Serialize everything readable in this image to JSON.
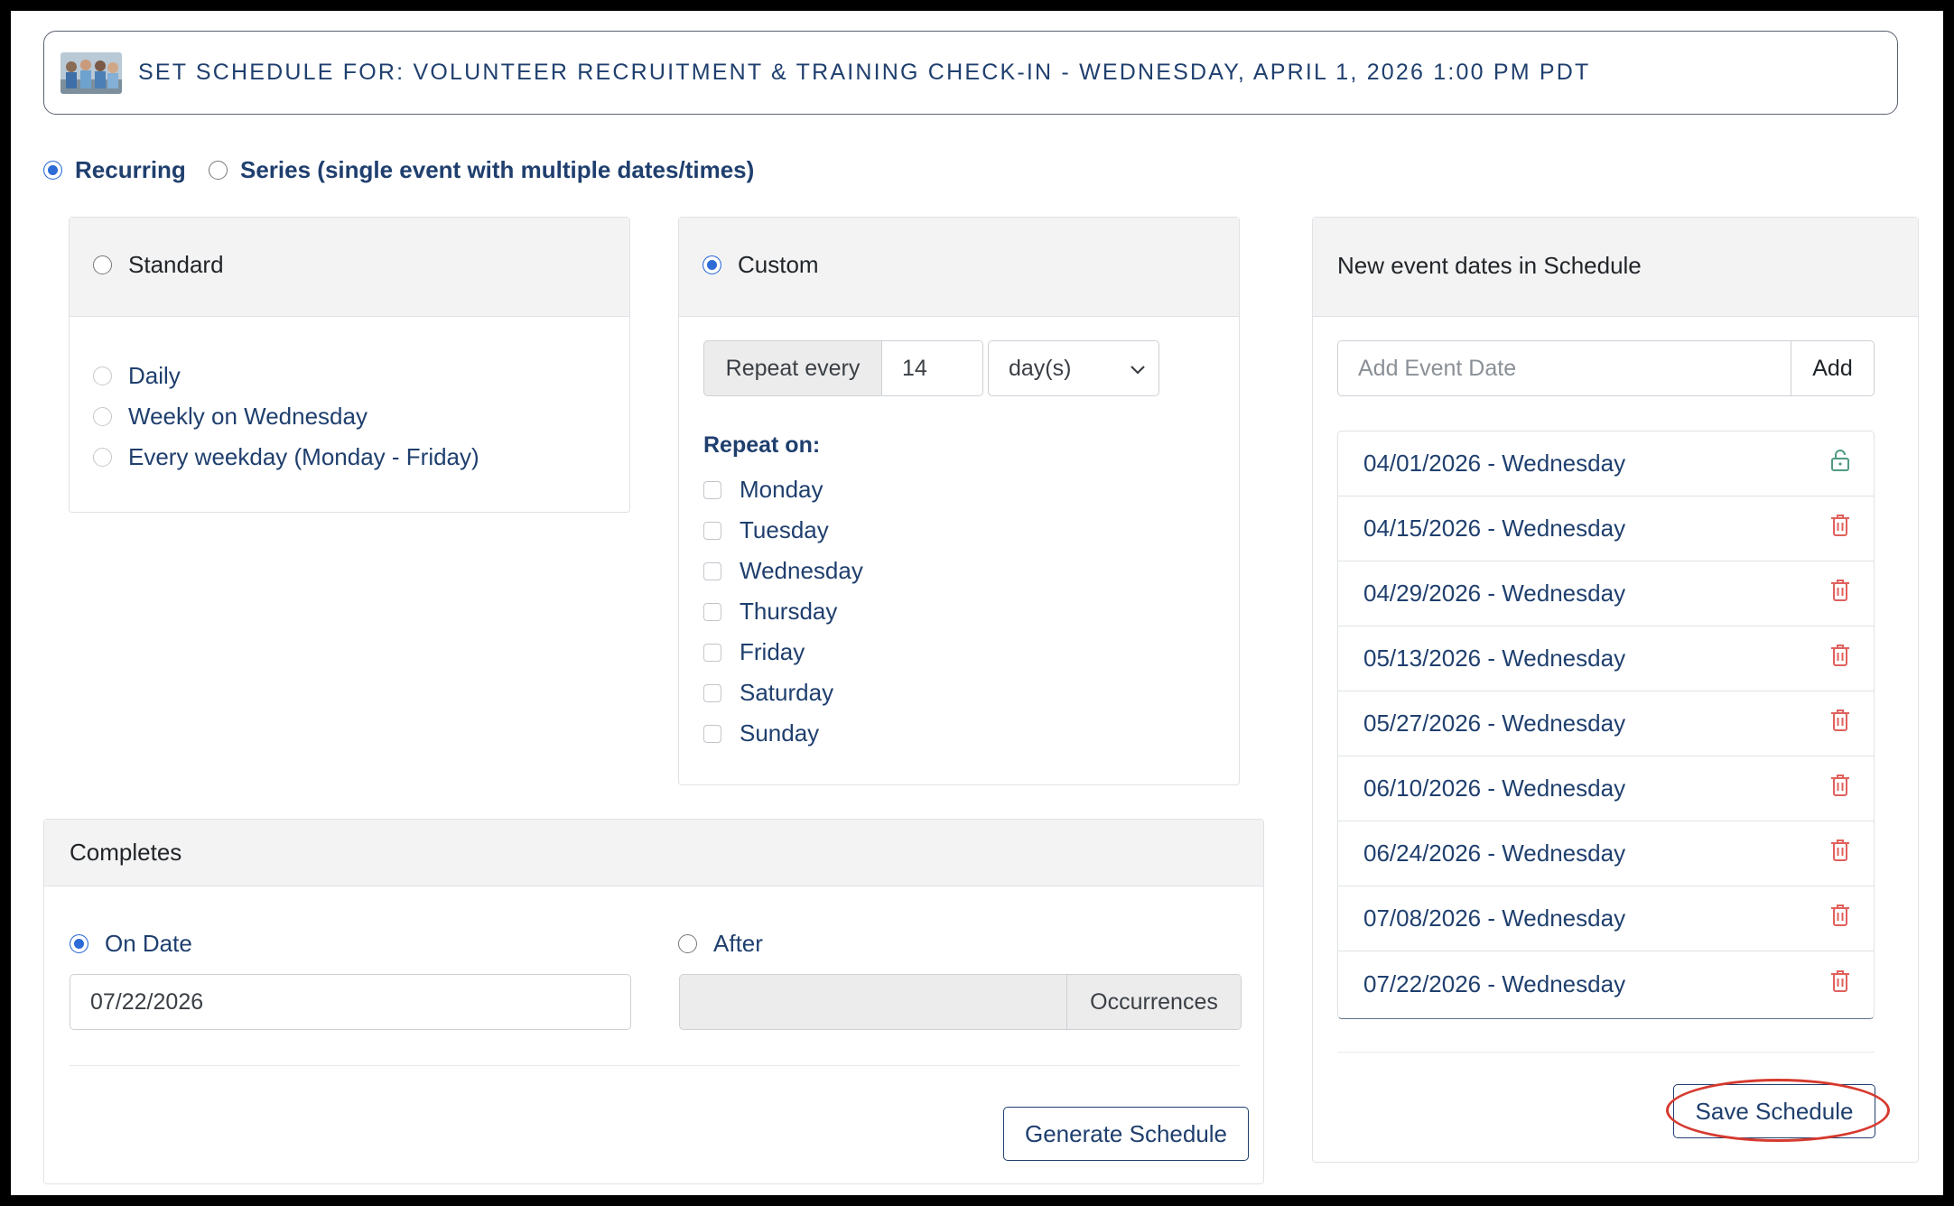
{
  "header": {
    "title": "SET SCHEDULE FOR: VOLUNTEER RECRUITMENT & TRAINING CHECK-IN - WEDNESDAY, APRIL 1, 2026 1:00 PM PDT"
  },
  "mode": {
    "recurring_label": "Recurring",
    "series_label": "Series (single event with multiple dates/times)"
  },
  "standard": {
    "label": "Standard",
    "options": [
      "Daily",
      "Weekly on Wednesday",
      "Every weekday (Monday - Friday)"
    ]
  },
  "custom": {
    "label": "Custom",
    "repeat_every_label": "Repeat every",
    "repeat_every_value": "14",
    "unit": "day(s)",
    "repeat_on_label": "Repeat on:",
    "days": [
      "Monday",
      "Tuesday",
      "Wednesday",
      "Thursday",
      "Friday",
      "Saturday",
      "Sunday"
    ]
  },
  "completes": {
    "label": "Completes",
    "on_date_label": "On Date",
    "on_date_value": "07/22/2026",
    "after_label": "After",
    "occurrences_label": "Occurrences",
    "generate_button": "Generate Schedule"
  },
  "schedule": {
    "title": "New event dates in Schedule",
    "add_placeholder": "Add Event Date",
    "add_button": "Add",
    "dates": [
      "04/01/2026 - Wednesday",
      "04/15/2026 - Wednesday",
      "04/29/2026 - Wednesday",
      "05/13/2026 - Wednesday",
      "05/27/2026 - Wednesday",
      "06/10/2026 - Wednesday",
      "06/24/2026 - Wednesday",
      "07/08/2026 - Wednesday",
      "07/22/2026 - Wednesday"
    ],
    "save_button": "Save Schedule"
  },
  "colors": {
    "navy": "#1f3f6e",
    "radio_blue": "#2d6bd6",
    "trash_red": "#e0605c",
    "lock_green": "#4f9a80",
    "highlight_red": "#d63a2f"
  }
}
